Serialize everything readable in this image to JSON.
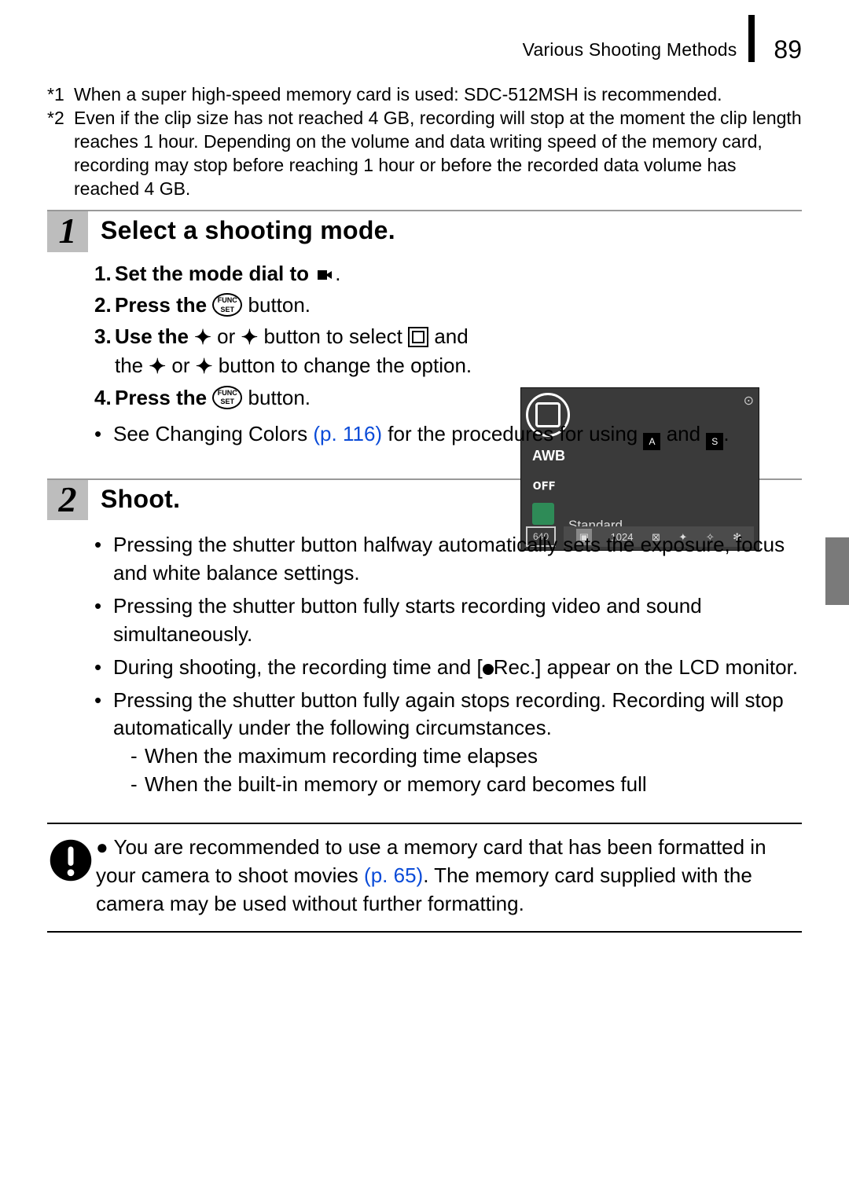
{
  "header": {
    "chapter": "Various Shooting Methods",
    "page_number": "89"
  },
  "notes": {
    "n1_label": "*1",
    "n1_text": "When a super high-speed memory card is used: SDC-512MSH is recommended.",
    "n2_label": "*2",
    "n2_text": "Even if the clip size has not reached 4 GB, recording will stop at the moment the clip length reaches 1 hour. Depending on the volume and data writing speed of the memory card, recording may stop before reaching 1 hour or before the recorded data volume has reached 4 GB."
  },
  "step1": {
    "num": "1",
    "title": "Select a shooting mode.",
    "li1a": "Set the mode dial to ",
    "li1b": ".",
    "li2a": "Press the ",
    "li2b": " button.",
    "li3a": "Use the ",
    "li3b": " or ",
    "li3c": " button to select ",
    "li3d": " and the ",
    "li3e": " or ",
    "li3f": " button to change the option.",
    "li4a": "Press the ",
    "li4b": " button.",
    "see_a": "See Changing Colors ",
    "see_link": "(p. 116)",
    "see_b": " for the procedures for using ",
    "see_c": " and ",
    "see_d": "."
  },
  "screenshot": {
    "awb": "AWB",
    "off": "ᴏꜰꜰ",
    "label": "Standard",
    "res": "640",
    "opt1024": "1024",
    "unlock": "⊙"
  },
  "step2": {
    "num": "2",
    "title": "Shoot.",
    "b1": "Pressing the shutter button halfway automatically sets the exposure, focus and white balance settings.",
    "b2": "Pressing the shutter button fully starts recording video and sound simultaneously.",
    "b3a": "During shooting, the recording time and [",
    "b3b": "Rec.] appear on the LCD monitor.",
    "b4": "Pressing the shutter button fully again stops recording. Recording will stop automatically under the following circumstances.",
    "d1": "When the maximum recording time elapses",
    "d2": "When the built-in memory or memory card becomes full"
  },
  "caution": {
    "bullet": "●",
    "t1": "You are recommended to use a memory card that has been formatted in your camera to shoot movies ",
    "link": "(p. 65)",
    "t2": ". The memory card supplied with the camera may be used without further formatting."
  }
}
